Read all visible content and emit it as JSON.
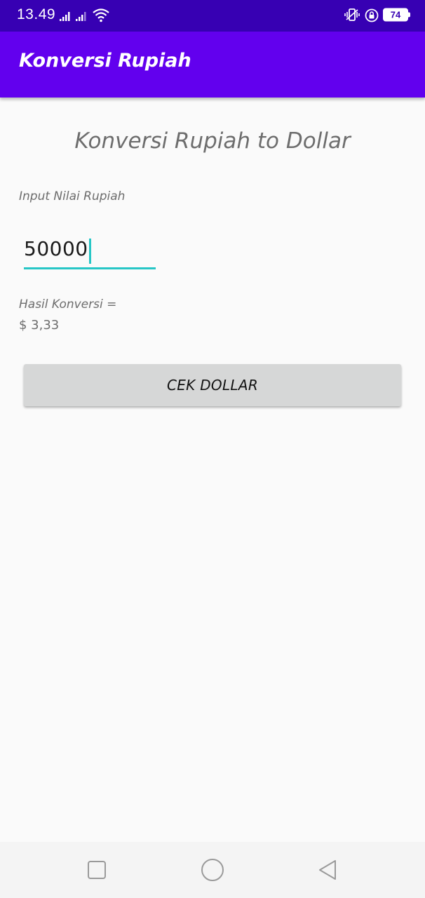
{
  "status_bar": {
    "time": "13.49",
    "battery": "74",
    "icons": [
      "signal-icon",
      "signal-icon",
      "wifi-icon",
      "vibrate-icon",
      "lock-rotation-icon",
      "battery-icon"
    ]
  },
  "app_bar": {
    "title": "Konversi Rupiah"
  },
  "main": {
    "heading": "Konversi Rupiah to Dollar",
    "input_label": "Input Nilai Rupiah",
    "input_value": "50000",
    "result_label": "Hasil Konversi =",
    "result_value": "$ 3,33",
    "button_label": "CEK DOLLAR"
  },
  "nav_bar": {
    "icons": [
      "recents-square-icon",
      "home-circle-icon",
      "back-triangle-icon"
    ]
  },
  "colors": {
    "status_bar": "#3700b3",
    "app_bar": "#6200ee",
    "accent": "#26c6c6",
    "button": "#d6d7d7",
    "background": "#fafafa"
  }
}
